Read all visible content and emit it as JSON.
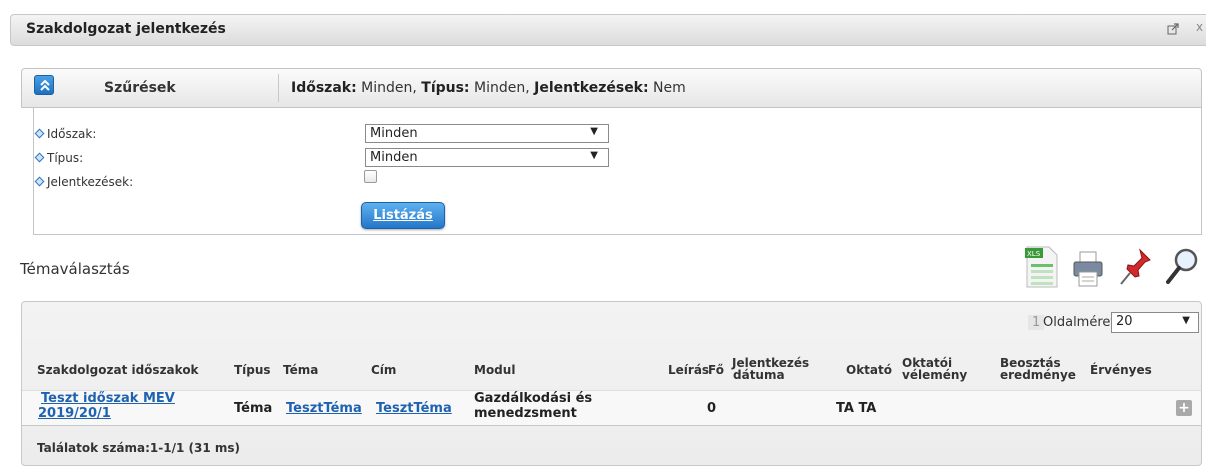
{
  "window": {
    "title": "Szakdolgozat jelentkezés",
    "popout_icon": "popout-icon",
    "close_glyph": "x"
  },
  "filters": {
    "panel_label": "Szűrések",
    "collapse_icon": "chevron-up-double-icon",
    "summary": [
      {
        "key": "Időszak:",
        "value": " Minden, "
      },
      {
        "key": "Típus:",
        "value": " Minden, "
      },
      {
        "key": "Jelentkezések:",
        "value": " Nem"
      }
    ],
    "fields": [
      {
        "label": "Időszak:",
        "value": "Minden"
      },
      {
        "label": "Típus:",
        "value": "Minden"
      },
      {
        "label": "Jelentkezések:",
        "checked": false
      }
    ],
    "list_button": "Listázás"
  },
  "section": {
    "title": "Témaválasztás",
    "tools": [
      "xls-export-icon",
      "print-icon",
      "pin-icon",
      "search-icon"
    ]
  },
  "table": {
    "page_number": "1",
    "page_size_label": "Oldalméret",
    "page_size_value": "20",
    "columns": [
      "Szakdolgozat időszakok",
      "Típus",
      "Téma",
      "Cím",
      "Modul",
      "Leírás",
      "Fő",
      "Jelentkezés dátuma",
      "Oktató",
      "Oktatói vélemény",
      "Beosztás eredménye",
      "Érvényes"
    ],
    "column_lines": {
      "jelentkezes": [
        "Jelentkezés",
        "dátuma"
      ],
      "oktatoi": [
        "Oktatói",
        "vélemény"
      ],
      "beosztas": [
        "Beosztás",
        "eredménye"
      ]
    },
    "rows": [
      {
        "idoszak_line1": "Teszt időszak MEV",
        "idoszak_line2": "2019/20/1",
        "tipus": "Téma",
        "tema": "TesztTéma",
        "cim": "TesztTéma",
        "modul_line1": "Gazdálkodási és",
        "modul_line2": "menedzsment",
        "leiras": "",
        "fo": "0",
        "jelentkezes_datuma": "",
        "oktato": "TA TA",
        "oktatoi_velemeny": "",
        "beosztas": "",
        "ervenyes": "",
        "action_icon": "plus-icon"
      }
    ],
    "footer": "Találatok száma:1-1/1 (31 ms)"
  }
}
